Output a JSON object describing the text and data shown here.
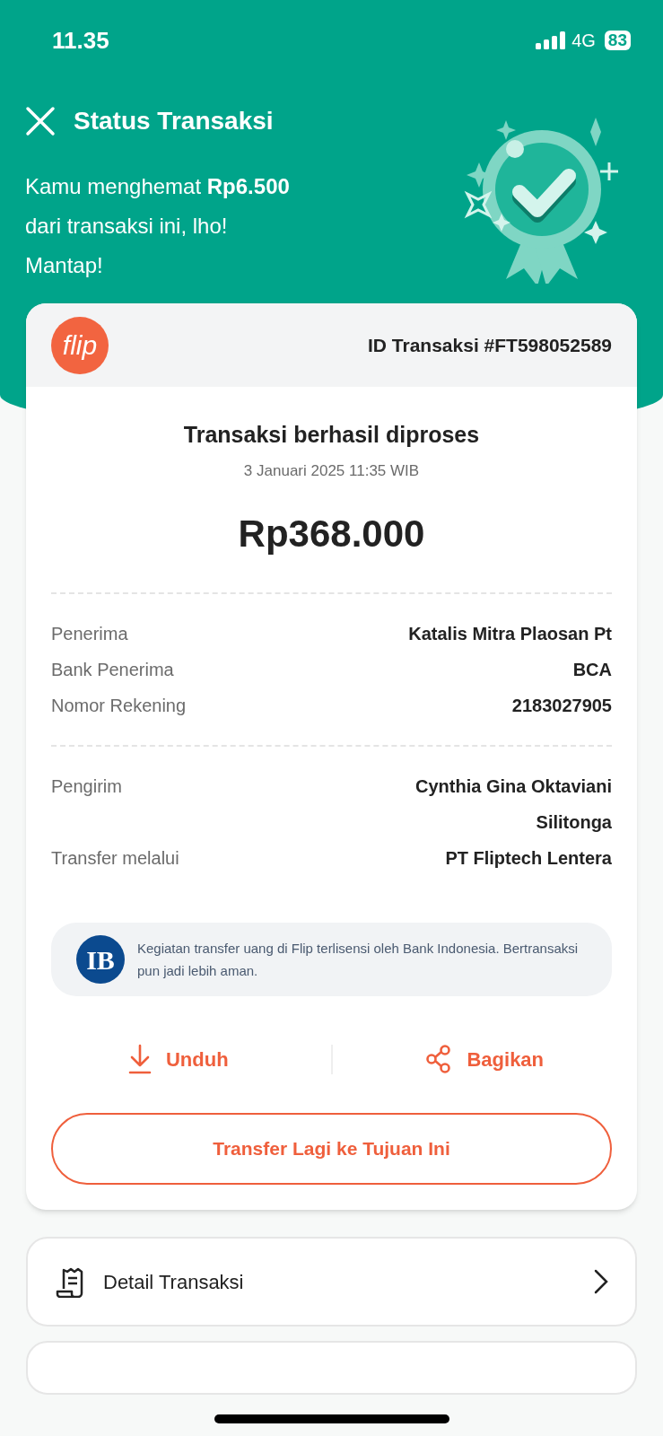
{
  "status_bar": {
    "time": "11.35",
    "network": "4G",
    "battery": "83"
  },
  "header": {
    "title": "Status Transaksi",
    "savings": "Kamu menghemat **Rp6.500**",
    "savings_line2": "dari transaksi ini, lho!",
    "savings_line3": "Mantap!"
  },
  "receipt": {
    "logo_text": "flip",
    "transaction_id": "ID Transaksi #FT598052589",
    "status": "Transaksi berhasil diproses",
    "date": "3 Januari 2025 11:35 WIB",
    "amount": "Rp368.000",
    "recipient_rows": [
      {
        "label": "Penerima",
        "value": "Katalis Mitra Plaosan Pt"
      },
      {
        "label": "Bank Penerima",
        "value": "BCA"
      },
      {
        "label": "Nomor Rekening",
        "value": "2183027905"
      }
    ],
    "sender_rows": [
      {
        "label": "Pengirim",
        "value": "Cynthia Gina Oktaviani Silitonga"
      },
      {
        "label": "Transfer melalui",
        "value": "PT Fliptech Lentera"
      }
    ],
    "notice": {
      "logo_text": "IB",
      "text": "Kegiatan transfer uang di Flip terlisensi oleh Bank Indonesia. Bertransaksi pun jadi lebih aman."
    },
    "actions": [
      {
        "kind": "download",
        "label": "Unduh"
      },
      {
        "kind": "share",
        "label": "Bagikan"
      }
    ],
    "repeat_button": "Transfer Lagi ke Tujuan Ini"
  },
  "detail_item": {
    "label": "Detail Transaksi"
  }
}
